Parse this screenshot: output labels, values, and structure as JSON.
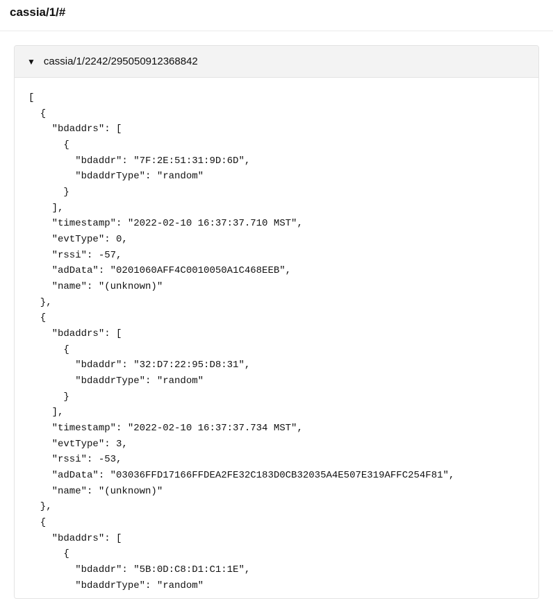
{
  "header": {
    "title": "cassia/1/#"
  },
  "panel": {
    "topic": "cassia/1/2242/295050912368842",
    "caret": "▼",
    "payload": [
      {
        "bdaddrs": [
          {
            "bdaddr": "7F:2E:51:31:9D:6D",
            "bdaddrType": "random"
          }
        ],
        "timestamp": "2022-02-10 16:37:37.710 MST",
        "evtType": 0,
        "rssi": -57,
        "adData": "0201060AFF4C0010050A1C468EEB",
        "name": "(unknown)"
      },
      {
        "bdaddrs": [
          {
            "bdaddr": "32:D7:22:95:D8:31",
            "bdaddrType": "random"
          }
        ],
        "timestamp": "2022-02-10 16:37:37.734 MST",
        "evtType": 3,
        "rssi": -53,
        "adData": "03036FFD17166FFDEA2FE32C183D0CB32035A4E507E319AFFC254F81",
        "name": "(unknown)"
      },
      {
        "bdaddrs": [
          {
            "bdaddr": "5B:0D:C8:D1:C1:1E",
            "bdaddrType": "random"
          }
        ]
      }
    ]
  }
}
